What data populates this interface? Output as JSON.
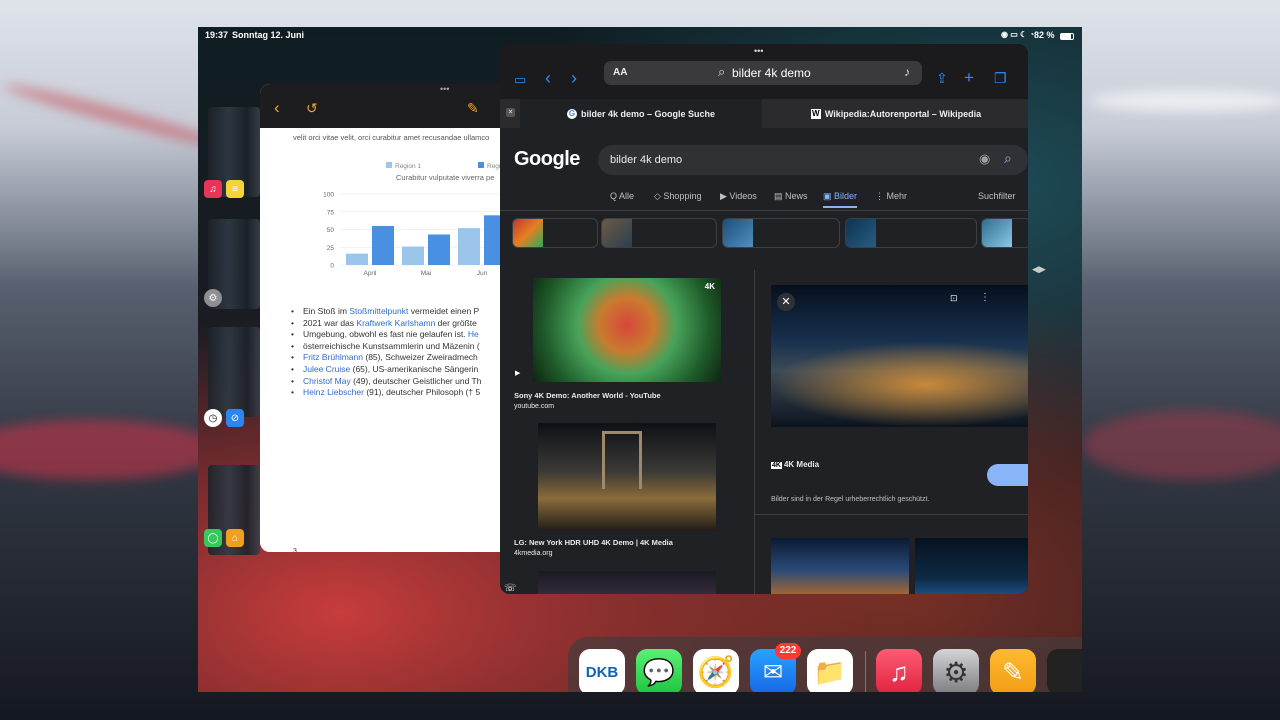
{
  "status_bar": {
    "time": "19:37",
    "date": "Sonntag 12. Juni",
    "battery": "82 %"
  },
  "document": {
    "menu_dots": "•••",
    "top_text": "velit orci vitae velit, orci curabitur amet recusandae ullamco",
    "chart_data": {
      "type": "bar",
      "title": "Curabitur vulputate viverra pe",
      "categories": [
        "April",
        "Mai",
        "Jun"
      ],
      "series": [
        {
          "name": "Region 1",
          "values": [
            16,
            26,
            52
          ]
        },
        {
          "name": "Region",
          "values": [
            55,
            43,
            70
          ]
        }
      ],
      "ylim": [
        0,
        100
      ],
      "yticks": [
        "100",
        "75",
        "50",
        "25",
        "0"
      ],
      "colors": [
        "#9cc5eb",
        "#4a90e2"
      ]
    },
    "bullets": [
      {
        "pre": "Ein Stoß im ",
        "link": "Stoßmittelpunkt",
        "post": " vermeidet einen P"
      },
      {
        "pre": "2021 war das ",
        "link": "Kraftwerk Karlshamn",
        "post": " der größte"
      },
      {
        "pre": "Umgebung, obwohl es fast nie gelaufen ist. ",
        "link": "He",
        "post": ""
      },
      {
        "pre": "österreichische Kunstsammlerin und Mäzenin (",
        "link": "",
        "post": ""
      },
      {
        "pre": "",
        "link": "Fritz Brühlmann",
        "post": " (85), Schweizer Zweiradmech"
      },
      {
        "pre": "",
        "link": "Julee Cruise",
        "post": " (65), US-amerikanische Sängerin"
      },
      {
        "pre": "",
        "link": "Christof May",
        "post": " (49), deutscher Geistlicher und Th"
      },
      {
        "pre": "",
        "link": "Heinz Liebscher",
        "post": " (91), deutscher Philosoph († 5"
      }
    ],
    "page_number": "3"
  },
  "safari": {
    "menu_dots": "•••",
    "url_text": "bilder 4k demo",
    "aa": "AA",
    "tabs": [
      {
        "title": "bilder 4k demo – Google Suche"
      },
      {
        "title": "Wikipedia:Autorenportal – Wikipedia"
      }
    ],
    "google": {
      "logo": "Google",
      "query": "bilder 4k demo",
      "nav": [
        "Alle",
        "Shopping",
        "Videos",
        "News",
        "Bilder",
        "Mehr"
      ],
      "nav_icons": [
        "Q",
        "◇",
        "▶",
        "▤",
        "▣",
        "⋮"
      ],
      "filter": "Suchfilter",
      "results": [
        {
          "title": "Sony 4K Demo: Another World - YouTube",
          "source": "youtube.com",
          "badge": "4K"
        },
        {
          "title": "LG: New York HDR UHD 4K Demo | 4K Media",
          "source": "4kmedia.org"
        }
      ],
      "preview": {
        "source": "4K Media",
        "source_icon": "4K",
        "note": "Bilder sind in der Regel urheberrechtlich geschützt."
      }
    }
  },
  "dock": {
    "mail_badge": "222",
    "dkb_label": "DKB"
  }
}
